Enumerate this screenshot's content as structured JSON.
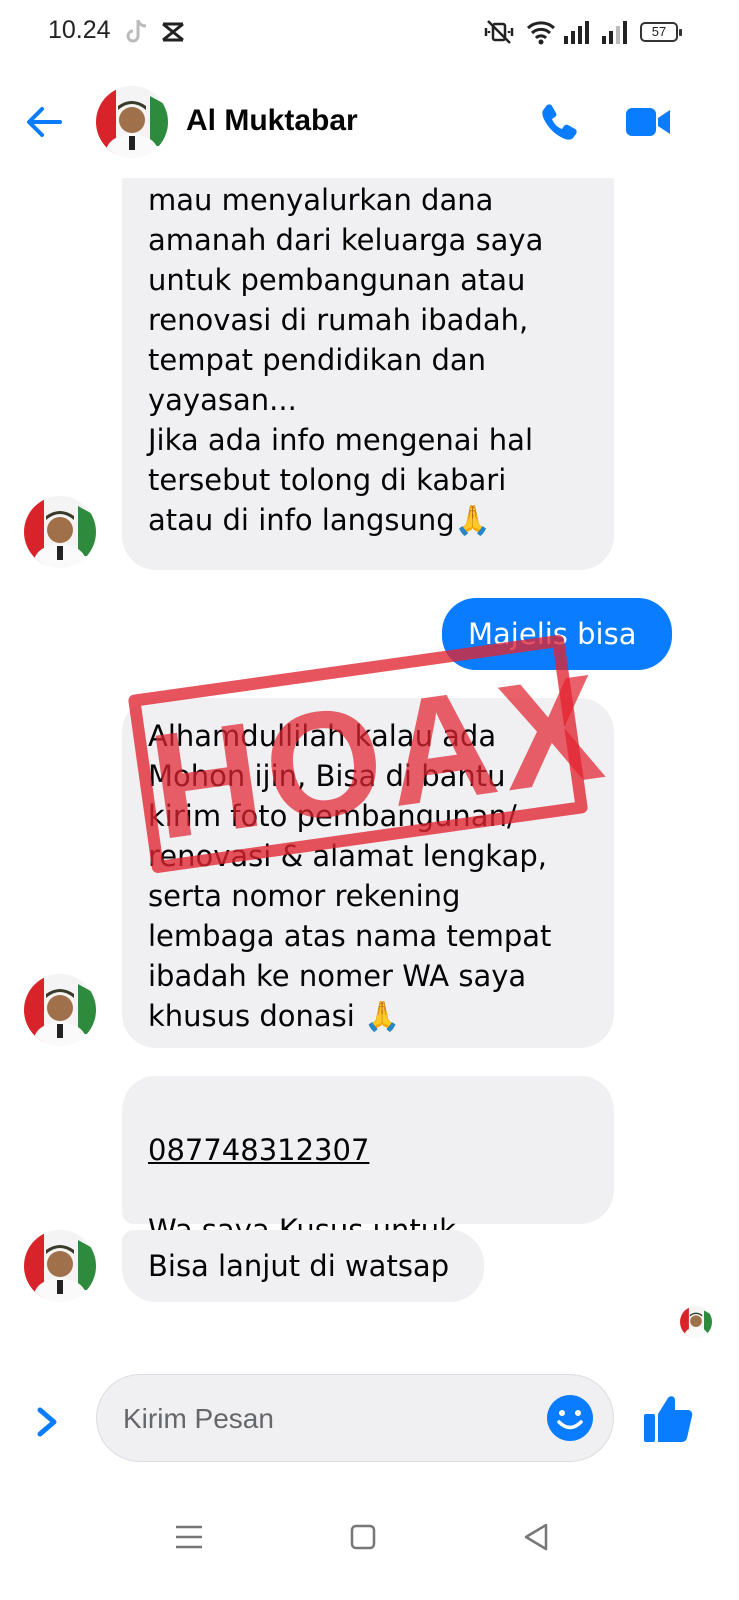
{
  "status_bar": {
    "time": "10.24",
    "battery": "57"
  },
  "header": {
    "contact_name": "Al Muktabar"
  },
  "messages": [
    {
      "from": "contact",
      "text": "rejeki dari allah swt, Saya\nmau menyalurkan dana\namanah dari keluarga saya\nuntuk pembangunan atau\nrenovasi di rumah ibadah,\ntempat pendidikan dan\nyayasan...\nJika ada info mengenai hal\ntersebut tolong di kabari\natau di info langsung🙏"
    },
    {
      "from": "me",
      "text": "Majelis bisa"
    },
    {
      "from": "contact",
      "text": "Alhamdullilah kalau ada\nMohon ijin, Bisa di bantu\nkirim foto pembangunan/\nrenovasi & alamat lengkap,\nserta nomor rekening\nlembaga atas nama tempat\nibadah ke nomer WA saya\nkhusus donasi 🙏"
    },
    {
      "from": "contact",
      "phone": "087748312307",
      "text": "Wa saya Kusus untuk\npenyaluran donasi🙏"
    },
    {
      "from": "contact",
      "text": "Bisa lanjut di watsap"
    }
  ],
  "stamp": {
    "text": "HOAX",
    "color": "#e22430"
  },
  "composer": {
    "placeholder": "Kirim Pesan"
  },
  "colors": {
    "accent": "#0a7cff",
    "bubble_incoming": "#f0f0f3"
  }
}
